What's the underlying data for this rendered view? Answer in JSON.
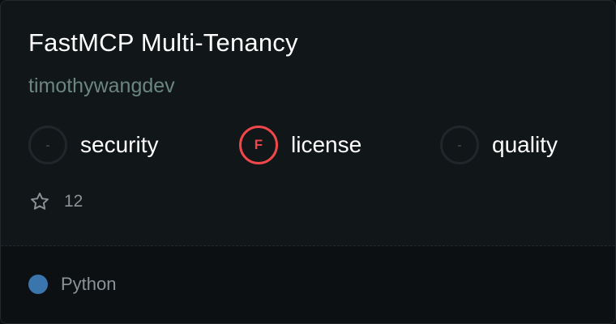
{
  "repo": {
    "title": "FastMCP Multi-Tenancy",
    "owner": "timothywangdev"
  },
  "scores": [
    {
      "label": "security",
      "grade": "-",
      "status": "none"
    },
    {
      "label": "license",
      "grade": "F",
      "status": "fail",
      "color": "#f0474a"
    },
    {
      "label": "quality",
      "grade": "-",
      "status": "none"
    }
  ],
  "stars": {
    "icon": "star-outline-icon",
    "count": "12"
  },
  "language": {
    "name": "Python",
    "color": "#3b75ad"
  }
}
